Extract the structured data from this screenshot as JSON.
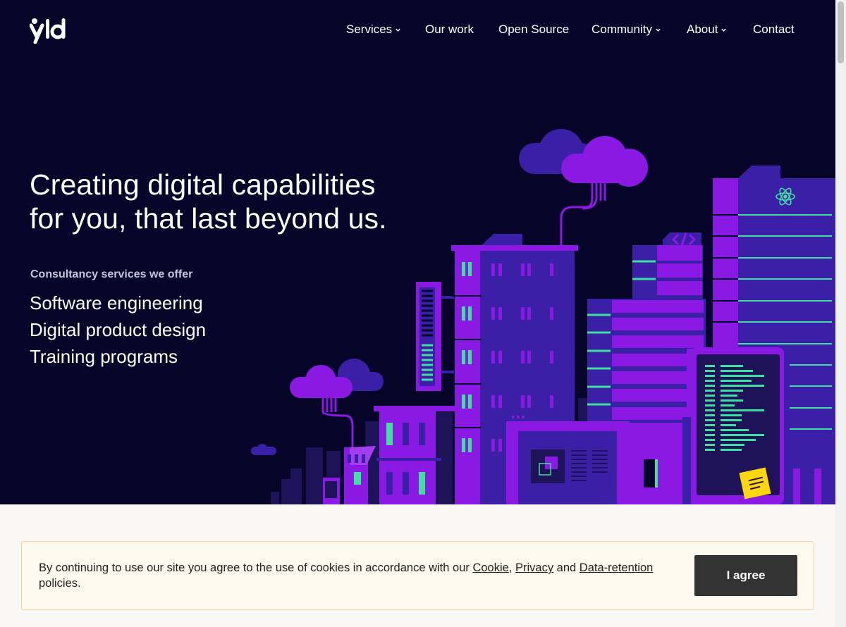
{
  "brand": {
    "logo_text": "yld"
  },
  "nav": {
    "items": [
      {
        "label": "Services",
        "has_dropdown": true
      },
      {
        "label": "Our work",
        "has_dropdown": false
      },
      {
        "label": "Open Source",
        "has_dropdown": false
      },
      {
        "label": "Community",
        "has_dropdown": true
      },
      {
        "label": "About",
        "has_dropdown": true
      },
      {
        "label": "Contact",
        "has_dropdown": false
      }
    ]
  },
  "hero": {
    "title_line1": "Creating digital capabilities",
    "title_line2": "for you, that last beyond us.",
    "services_label": "Consultancy services we offer",
    "services": [
      "Software engineering",
      "Digital product design",
      "Training programs"
    ]
  },
  "cookie": {
    "text_before": "By continuing to use our site you agree to the use of cookies in accordance with our ",
    "link_cookie": "Cookie",
    "sep1": ", ",
    "link_privacy": "Privacy",
    "sep2": " and ",
    "link_retention": "Data-retention",
    "text_after": " policies.",
    "button_label": "I agree"
  },
  "colors": {
    "hero_bg": "#07042a",
    "purple": "#8a19e3",
    "violet": "#3b1fa6",
    "green": "#3ee0a0",
    "button_bg": "#333333",
    "cookie_bg": "#fef9ef"
  },
  "icons": [
    "yld-logo",
    "chevron-down-icon",
    "react-atom-icon",
    "code-tag-icon",
    "sticky-note-icon"
  ]
}
